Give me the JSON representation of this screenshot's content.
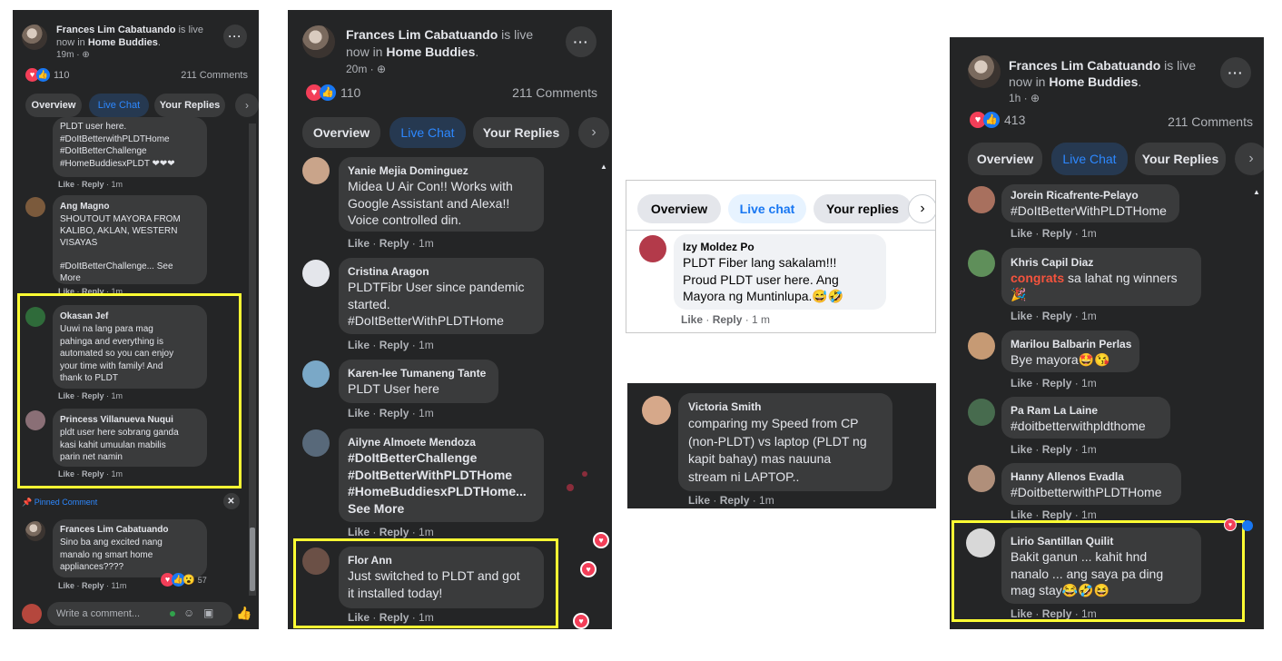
{
  "panel1": {
    "header": {
      "poster": "Frances Lim Cabatuando",
      "status_pre": " is live now in ",
      "group": "Home Buddies",
      "status_post": ".",
      "time": "19m · ",
      "globe_icon": "globe-icon"
    },
    "reactions": "110",
    "comments_count": "211 Comments",
    "tabs": [
      "Overview",
      "Live Chat",
      "Your Replies"
    ],
    "comments": [
      {
        "name": "",
        "text": "PLDT user here.\n#DoItBetterwithPLDTHome\n#DoItBetterChallenge\n#HomeBuddiesxPLDT ❤❤❤",
        "meta_like": "Like",
        "meta_reply": "Reply",
        "meta_time": "1m"
      },
      {
        "name": "Ang Magno",
        "text": "SHOUTOUT MAYORA FROM\nKALIBO, AKLAN, WESTERN\nVISAYAS\n\n#DoItBetterChallenge... See\nMore",
        "meta_like": "Like",
        "meta_reply": "Reply",
        "meta_time": "1m"
      },
      {
        "name": "Okasan Jef",
        "text": "Uuwi na lang para mag\npahinga and everything is\nautomated so you can enjoy\nyour time with family! And\nthank to PLDT",
        "meta_like": "Like",
        "meta_reply": "Reply",
        "meta_time": "1m"
      },
      {
        "name": "Princess Villanueva Nuqui",
        "text": "pldt user here sobrang ganda\nkasi kahit umuulan mabilis\nparin net namin",
        "meta_like": "Like",
        "meta_reply": "Reply",
        "meta_time": "1m"
      }
    ],
    "pinned_label": "Pinned Comment",
    "pinned": {
      "name": "Frances Lim Cabatuando",
      "text": "Sino ba ang excited nang\nmanalo ng smart home\nappliances????",
      "meta_like": "Like",
      "meta_reply": "Reply",
      "meta_time": "11m",
      "reaction_count": "57"
    },
    "input_placeholder": "Write a comment..."
  },
  "panel2": {
    "header": {
      "poster": "Frances Lim Cabatuando",
      "status_pre": " is live now in ",
      "group": "Home Buddies",
      "status_post": ".",
      "time": "20m · "
    },
    "reactions": "110",
    "comments_count": "211 Comments",
    "tabs": [
      "Overview",
      "Live Chat",
      "Your Replies"
    ],
    "comments": [
      {
        "name": "Yanie Mejia Dominguez",
        "text": "Midea U Air Con!! Works with\nGoogle Assistant and Alexa!!\nVoice controlled din.",
        "meta_like": "Like",
        "meta_reply": "Reply",
        "meta_time": "1m"
      },
      {
        "name": "Cristina Aragon",
        "text": "PLDTFibr User since pandemic\nstarted.\n#DoItBetterWithPLDTHome",
        "meta_like": "Like",
        "meta_reply": "Reply",
        "meta_time": "1m"
      },
      {
        "name": "Karen-lee Tumaneng Tante",
        "text": "PLDT User here",
        "meta_like": "Like",
        "meta_reply": "Reply",
        "meta_time": "1m"
      },
      {
        "name": "Ailyne Almoete Mendoza",
        "text": "#DoItBetterChallenge\n#DoItBetterWithPLDTHome\n#HomeBuddiesxPLDTHome...\nSee More",
        "meta_like": "Like",
        "meta_reply": "Reply",
        "meta_time": "1m"
      },
      {
        "name": "Flor Ann",
        "text": "Just switched to PLDT and got\nit installed today!",
        "meta_like": "Like",
        "meta_reply": "Reply",
        "meta_time": "1m"
      }
    ]
  },
  "panel3": {
    "tabs": [
      "Overview",
      "Live chat",
      "Your replies"
    ],
    "comment": {
      "name": "Izy Moldez Po",
      "text": "PLDT Fiber lang sakalam!!!\nProud PLDT user here. Ang\nMayora ng Muntinlupa.😅🤣",
      "meta_like": "Like",
      "meta_reply": "Reply",
      "meta_time": "1 m"
    }
  },
  "panel4": {
    "comment": {
      "name": "Victoria Smith",
      "text": "comparing my Speed from CP\n(non-PLDT) vs laptop (PLDT ng\nkapit bahay) mas nauuna\nstream ni LAPTOP..",
      "meta_like": "Like",
      "meta_reply": "Reply",
      "meta_time": "1m"
    }
  },
  "panel5": {
    "header": {
      "poster": "Frances Lim Cabatuando",
      "status_pre": " is live now in ",
      "group": "Home Buddies",
      "status_post": ".",
      "time": "1h · "
    },
    "reactions": "413",
    "comments_count": "211 Comments",
    "tabs": [
      "Overview",
      "Live Chat",
      "Your Replies"
    ],
    "comments": [
      {
        "name": "Jorein Ricafrente-Pelayo",
        "text": "#DoItBetterWithPLDTHome",
        "meta_like": "Like",
        "meta_reply": "Reply",
        "meta_time": "1m"
      },
      {
        "name": "Khris Capil Diaz",
        "text_pre": "",
        "text_highlight": "congrats",
        "text_post": " sa lahat ng winners\n🎉",
        "meta_like": "Like",
        "meta_reply": "Reply",
        "meta_time": "1m"
      },
      {
        "name": "Marilou Balbarin Perlas",
        "text": "Bye mayora🤩😘",
        "meta_like": "Like",
        "meta_reply": "Reply",
        "meta_time": "1m"
      },
      {
        "name": "Pa Ram La Laine",
        "text": "#doitbetterwithpldthome",
        "meta_like": "Like",
        "meta_reply": "Reply",
        "meta_time": "1m"
      },
      {
        "name": "Hanny Allenos Evadla",
        "text": "#DoitbetterwithPLDTHome",
        "meta_like": "Like",
        "meta_reply": "Reply",
        "meta_time": "1m"
      },
      {
        "name": "Lirio Santillan Quilit",
        "text": "Bakit ganun ... kahit hnd\nnanalo ... ang saya pa ding\nmag stay😂🤣😆",
        "meta_like": "Like",
        "meta_reply": "Reply",
        "meta_time": "1m"
      }
    ]
  },
  "colors": {
    "panel_bg": "#242526",
    "bubble": "#3a3b3c",
    "accent": "#2d88ff",
    "highlight": "#ffff33",
    "love": "#f33e58",
    "like": "#1877f2"
  }
}
